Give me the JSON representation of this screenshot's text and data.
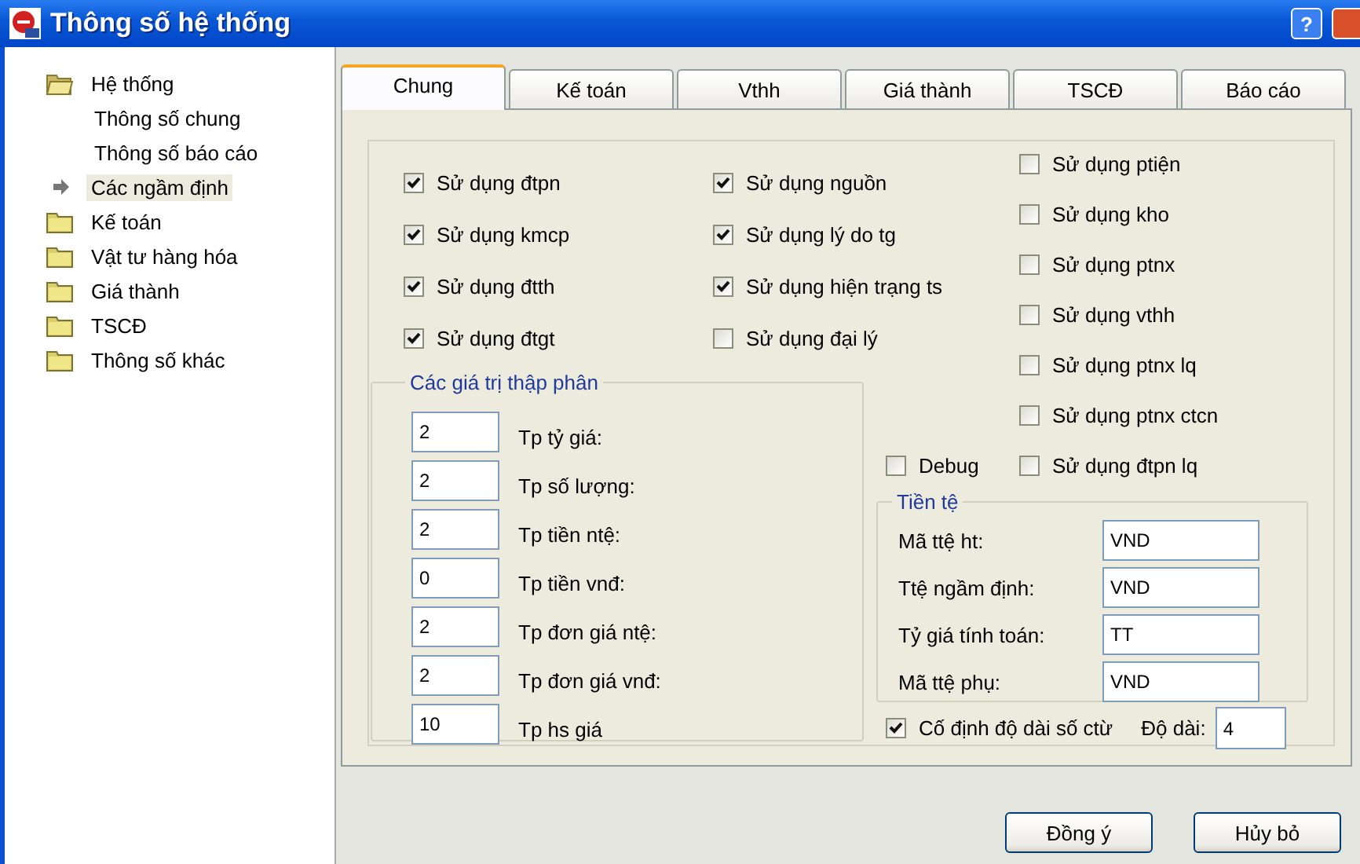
{
  "window": {
    "title": "Thông số hệ thống",
    "help_button": "?"
  },
  "tree": [
    {
      "label": "Hệ thống",
      "expanded": true,
      "children": [
        {
          "label": "Thông số chung",
          "selected": false
        },
        {
          "label": "Thông số báo cáo",
          "selected": false
        },
        {
          "label": "Các ngầm định",
          "selected": true
        }
      ]
    },
    {
      "label": "Kế toán",
      "expanded": false
    },
    {
      "label": "Vật tư hàng hóa",
      "expanded": false
    },
    {
      "label": "Giá thành",
      "expanded": false
    },
    {
      "label": "TSCĐ",
      "expanded": false
    },
    {
      "label": "Thông số khác",
      "expanded": false
    }
  ],
  "tabs": [
    {
      "label": "Chung",
      "selected": true
    },
    {
      "label": "Kế toán",
      "selected": false
    },
    {
      "label": "Vthh",
      "selected": false
    },
    {
      "label": "Giá thành",
      "selected": false
    },
    {
      "label": "TSCĐ",
      "selected": false
    },
    {
      "label": "Báo cáo",
      "selected": false
    }
  ],
  "options": {
    "column_1": [
      {
        "label": "Sử dụng đtpn",
        "checked": true
      },
      {
        "label": "Sử dụng kmcp",
        "checked": true
      },
      {
        "label": "Sử dụng đtth",
        "checked": true
      },
      {
        "label": "Sử dụng đtgt",
        "checked": true
      }
    ],
    "column_2": [
      {
        "label": "Sử dụng nguồn",
        "checked": true
      },
      {
        "label": "Sử dụng lý do tg",
        "checked": true
      },
      {
        "label": "Sử dụng hiện trạng ts",
        "checked": true
      },
      {
        "label": "Sử dụng đại lý",
        "checked": false
      }
    ],
    "column_3": [
      {
        "label": "Sử dụng ptiện",
        "checked": false
      },
      {
        "label": "Sử dụng kho",
        "checked": false
      },
      {
        "label": "Sử dụng ptnx",
        "checked": false
      },
      {
        "label": "Sử dụng vthh",
        "checked": false
      },
      {
        "label": "Sử dụng ptnx lq",
        "checked": false
      },
      {
        "label": "Sử dụng ptnx ctcn",
        "checked": false
      },
      {
        "label": "Sử dụng đtpn lq",
        "checked": false
      }
    ]
  },
  "debug": {
    "label": "Debug",
    "checked": false
  },
  "decimals": {
    "title": "Các giá trị thập phân",
    "fields": [
      {
        "label": "Tp tỷ giá:",
        "value": "2"
      },
      {
        "label": "Tp số lượng:",
        "value": "2"
      },
      {
        "label": "Tp tiền ntệ:",
        "value": "2"
      },
      {
        "label": "Tp tiền vnđ:",
        "value": "0"
      },
      {
        "label": "Tp đơn giá ntệ:",
        "value": "2"
      },
      {
        "label": "Tp đơn giá vnđ:",
        "value": "2"
      },
      {
        "label": "Tp hs giá",
        "value": "10"
      }
    ]
  },
  "currency": {
    "title": "Tiền tệ",
    "fields": [
      {
        "label": "Mã ttệ ht:",
        "value": "VND"
      },
      {
        "label": "Ttệ ngầm định:",
        "value": "VND"
      },
      {
        "label": "Tỷ giá tính toán:",
        "value": "TT"
      },
      {
        "label": "Mã ttệ phụ:",
        "value": "VND"
      }
    ]
  },
  "fixed_length": {
    "label": "Cố định độ dài số ctừ",
    "checked": true,
    "length_label": "Độ dài:",
    "length_value": "4"
  },
  "buttons": [
    "Đồng ý",
    "Hủy bỏ"
  ]
}
